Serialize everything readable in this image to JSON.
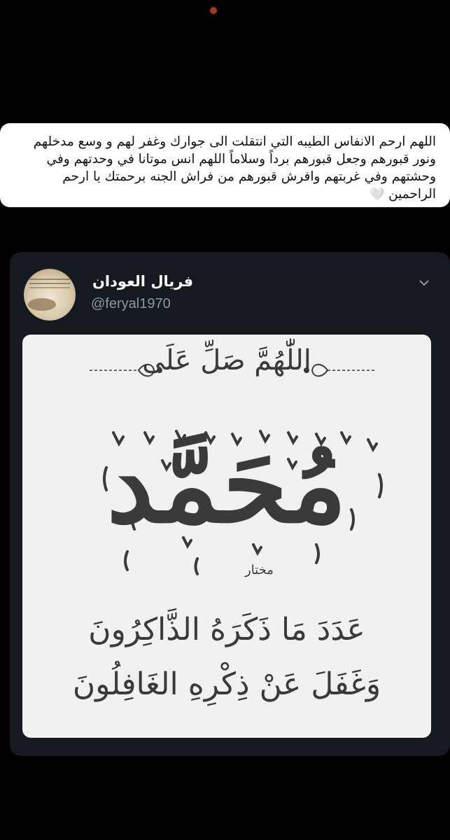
{
  "caption": {
    "text": "اللهم ارحم الانفاس الطيبه التي انتقلت الى جوارك وغفر لهم و وسع مدخلهم ونور قبورهم وجعل قبورهم برداً وسلاماً اللهم انس موتانا في وحدتهم وفي وحشتهم وفي غربتهم وافرش قبورهم من فراش الجنه برحمتك يا ارحم الراحمين",
    "heart": "🤍"
  },
  "tweet": {
    "display_name": "فريال العودان",
    "handle": "@feryal1970",
    "menu_icon": "chevron-down-icon",
    "image": {
      "line_top": "اللّٰهُمَّ صَلِّ عَلَى",
      "name": "مُحَمَّد",
      "small_word": "مختار",
      "line_1": "عَدَدَ مَا ذَكَرَهُ الذَّاكِرُونَ",
      "line_2": "وَغَفَلَ عَنْ ذِكْرِهِ الغَافِلُونَ"
    }
  },
  "colors": {
    "page_background": "#000000",
    "card_background": "#151a21",
    "handle_color": "#8b98a5",
    "calligraphy_ink": "#3a3a3a",
    "image_background": "#f1f1f0"
  }
}
